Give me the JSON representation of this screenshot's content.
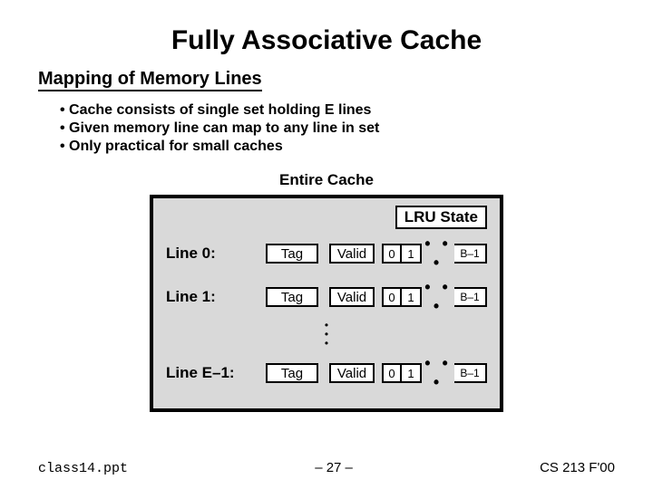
{
  "title": "Fully Associative Cache",
  "subtitle": "Mapping of Memory Lines",
  "bullets": [
    "Cache consists of single set holding E lines",
    "Given memory line can map to any line in set",
    "Only practical for small caches"
  ],
  "cache_label": "Entire Cache",
  "lru_label": "LRU State",
  "lines": {
    "l0": "Line 0:",
    "l1": "Line 1:",
    "le": "Line E–1:"
  },
  "cell": {
    "tag": "Tag",
    "valid": "Valid",
    "b0": "0",
    "b1": "1",
    "ell": "• • •",
    "last": "B–1"
  },
  "footer": {
    "file": "class14.ppt",
    "page": "– 27 –",
    "course": "CS 213 F'00"
  }
}
